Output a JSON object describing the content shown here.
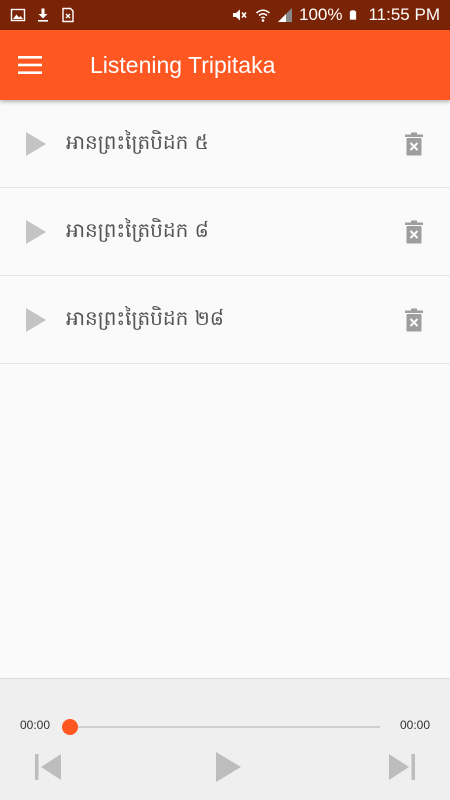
{
  "status_bar": {
    "battery_percent": "100%",
    "time": "11:55 PM",
    "left_icons": [
      "image-icon",
      "download-icon",
      "sim-icon"
    ],
    "right_icons": [
      "mute-icon",
      "wifi-icon",
      "signal-icon",
      "battery-icon"
    ]
  },
  "app_bar": {
    "title": "Listening Tripitaka",
    "menu_icon": "hamburger-menu-icon"
  },
  "tracks": [
    {
      "title": "អានព្រះត្រៃបិដក ៥"
    },
    {
      "title": "អានព្រះត្រៃបិដក ៨"
    },
    {
      "title": "អានព្រះត្រៃបិដក ២៨"
    }
  ],
  "player": {
    "current_time": "00:00",
    "total_time": "00:00",
    "progress": 0
  },
  "colors": {
    "accent": "#ff5722",
    "status_bar": "#7a2407",
    "icon_gray": "#bdbdbd"
  }
}
